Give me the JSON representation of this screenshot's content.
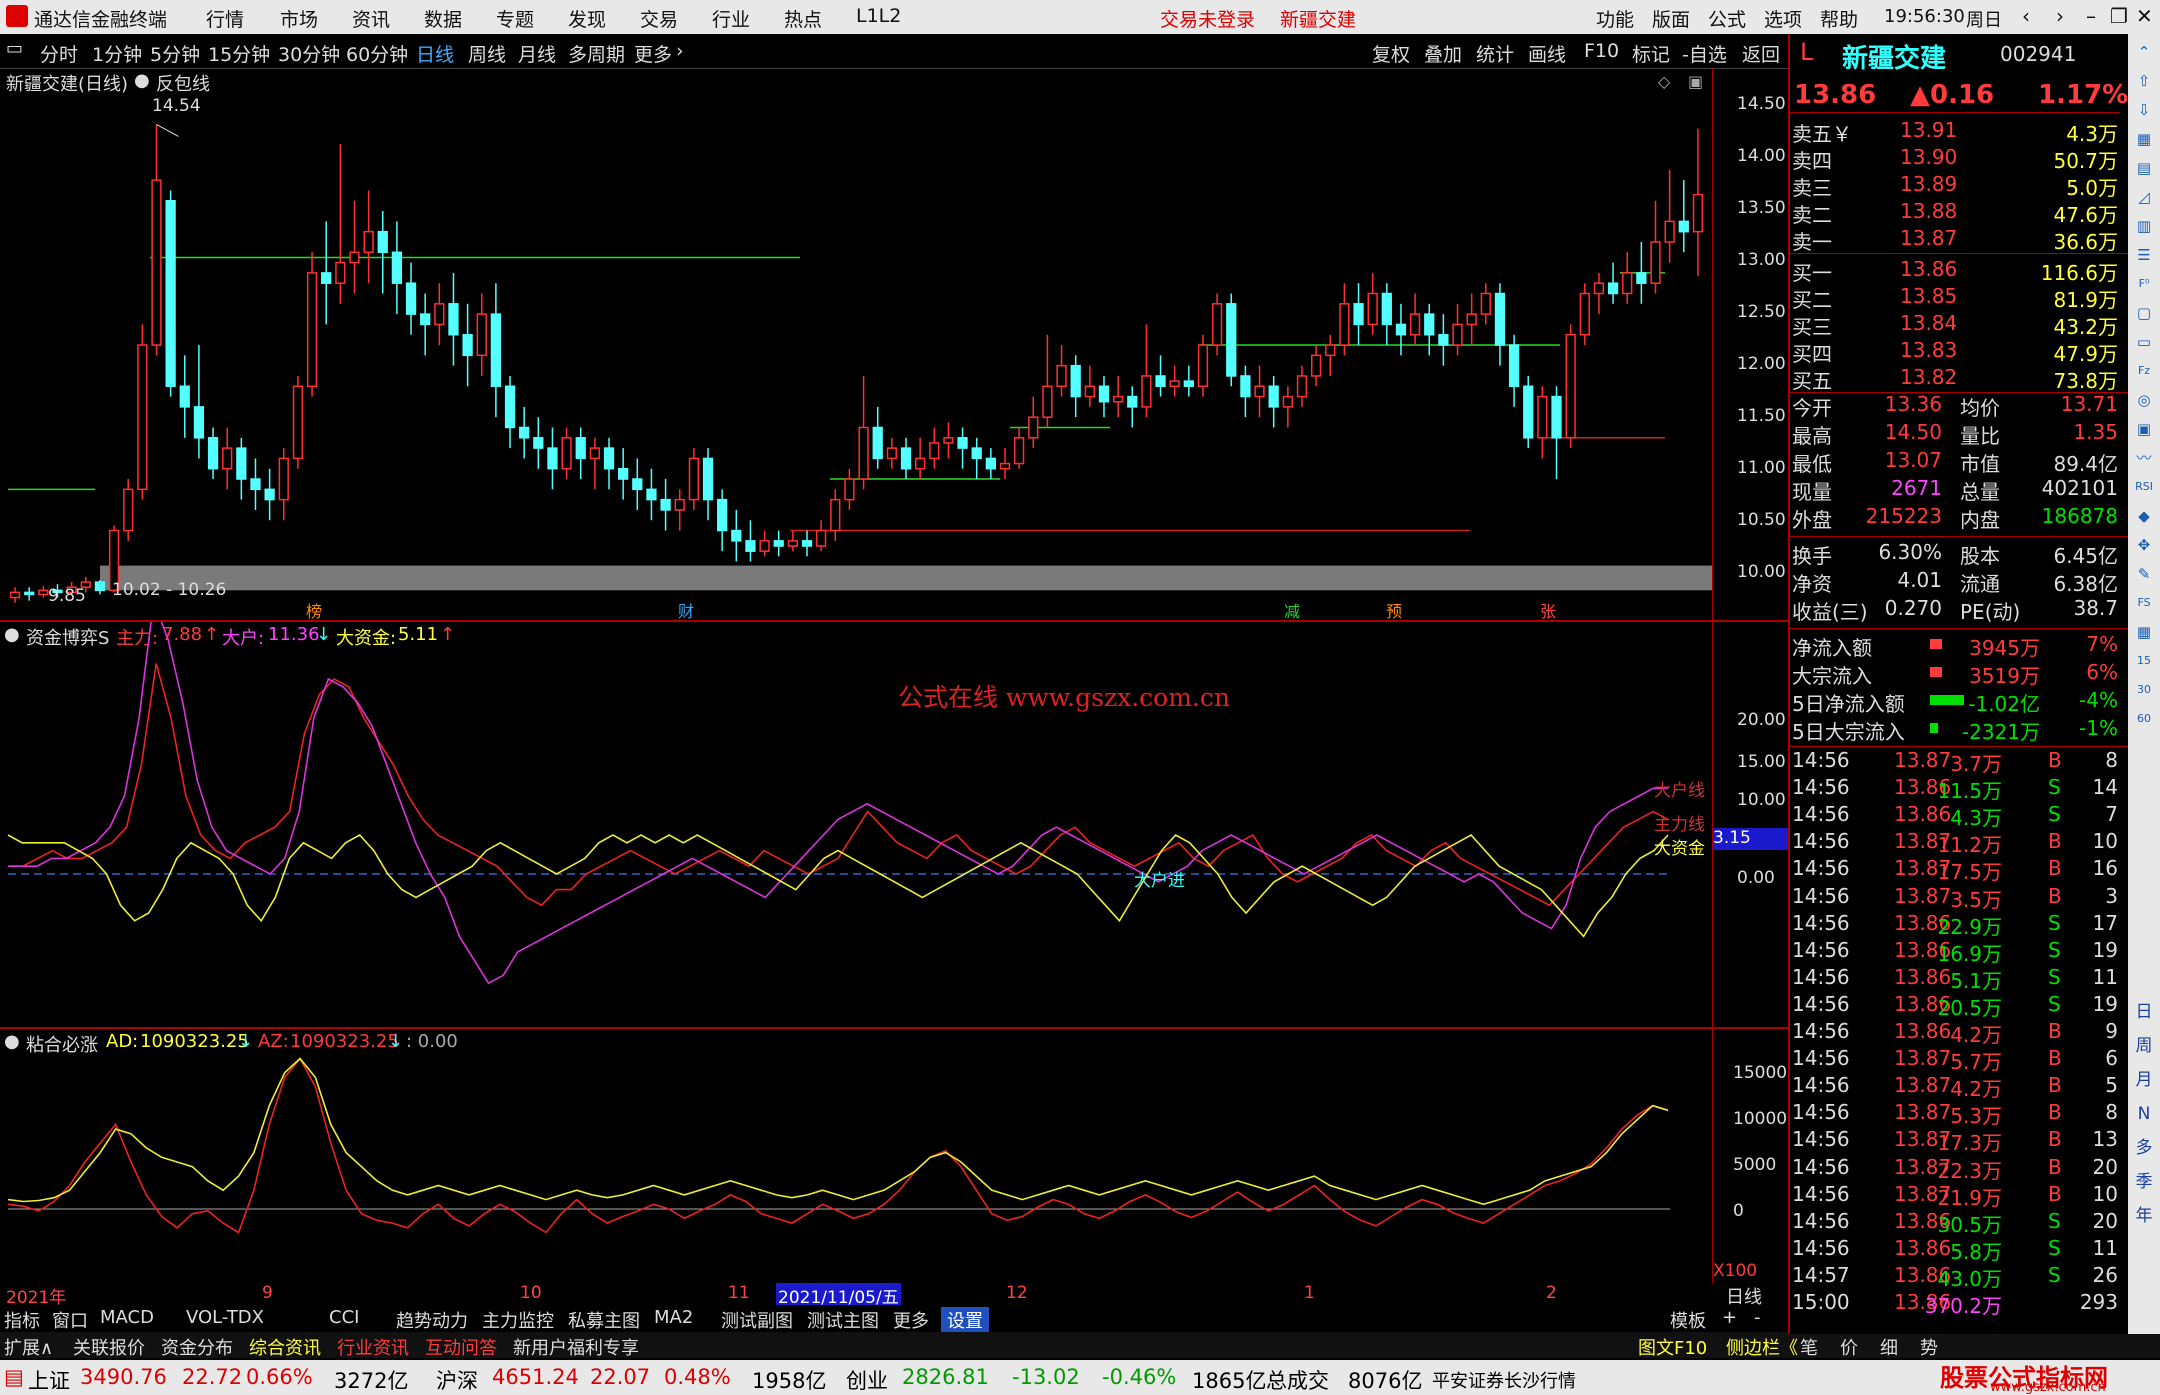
{
  "menu": {
    "app_title": "通达信金融终端",
    "items": [
      "行情",
      "市场",
      "资讯",
      "数据",
      "专题",
      "发现",
      "交易",
      "行业",
      "热点",
      "L1L2"
    ],
    "login_status": "交易未登录",
    "stock_name_menu": "新疆交建",
    "right_items": [
      "功能",
      "版面",
      "公式",
      "选项",
      "帮助"
    ],
    "time": "19:56:30",
    "weekday": "周日"
  },
  "periods": {
    "items": [
      "分时",
      "1分钟",
      "5分钟",
      "15分钟",
      "30分钟",
      "60分钟",
      "日线",
      "周线",
      "月线",
      "多周期",
      "更多"
    ],
    "active": "日线",
    "right": [
      "复权",
      "叠加",
      "统计",
      "画线",
      "F10",
      "标记",
      "-自选",
      "返回"
    ]
  },
  "main_chart": {
    "title": "新疆交建(日线)",
    "indicator": "反包线",
    "high_label": "14.54",
    "low_label": "9.85",
    "range_label": "10.02 - 10.26",
    "y_ticks": [
      "14.50",
      "14.00",
      "13.50",
      "13.00",
      "12.50",
      "12.00",
      "11.50",
      "11.00",
      "10.50",
      "10.00"
    ],
    "markers": [
      {
        "text": "榜",
        "color": "#ff8c00"
      },
      {
        "text": "财",
        "color": "#3af"
      },
      {
        "text": "减",
        "color": "#3c3"
      },
      {
        "text": "预",
        "color": "#ff8c00"
      },
      {
        "text": "张",
        "color": "#f44"
      }
    ]
  },
  "fund_chart": {
    "title": "资金博弈S",
    "main_label": "主力:",
    "main_value": "7.88",
    "big_label": "大户:",
    "big_value": "11.36",
    "large_label": "大资金:",
    "large_value": "5.11",
    "watermark": "公式在线 www.gszx.com.cn",
    "y_ticks": [
      "20.00",
      "15.00",
      "10.00",
      "5.00",
      "0.00"
    ],
    "tag_big": "大户线",
    "tag_main": "主力线",
    "tag_large": "大资金",
    "current": "3.15",
    "zero_label": "大户进"
  },
  "ad_chart": {
    "title": "粘合必涨",
    "ad_label": "AD:",
    "ad_value": "1090323.25",
    "az_label": "AZ:",
    "az_value": "1090323.25",
    "tail": ": 0.00",
    "y_ticks": [
      "15000",
      "10000",
      "5000",
      "0"
    ],
    "unit": "X100"
  },
  "date_axis": {
    "labels": [
      "2021年",
      "9",
      "10",
      "11",
      "2021/11/05/五",
      "12",
      "1",
      "2"
    ],
    "right": "日线"
  },
  "quote": {
    "l_icon": "L",
    "name": "新疆交建",
    "code": "002941",
    "price": "13.86",
    "change": "▲0.16",
    "pct": "1.17%",
    "asks": [
      {
        "label": "卖五￥",
        "price": "13.91",
        "vol": "4.3万"
      },
      {
        "label": "卖四",
        "price": "13.90",
        "vol": "50.7万"
      },
      {
        "label": "卖三",
        "price": "13.89",
        "vol": "5.0万"
      },
      {
        "label": "卖二",
        "price": "13.88",
        "vol": "47.6万"
      },
      {
        "label": "卖一",
        "price": "13.87",
        "vol": "36.6万"
      }
    ],
    "bids": [
      {
        "label": "买一",
        "price": "13.86",
        "vol": "116.6万"
      },
      {
        "label": "买二",
        "price": "13.85",
        "vol": "81.9万"
      },
      {
        "label": "买三",
        "price": "13.84",
        "vol": "43.2万"
      },
      {
        "label": "买四",
        "price": "13.83",
        "vol": "47.9万"
      },
      {
        "label": "买五",
        "price": "13.82",
        "vol": "73.8万"
      }
    ],
    "stats": [
      {
        "l1": "今开",
        "v1": "13.36",
        "c1": "red",
        "l2": "均价",
        "v2": "13.71",
        "c2": "red"
      },
      {
        "l1": "最高",
        "v1": "14.50",
        "c1": "red",
        "l2": "量比",
        "v2": "1.35",
        "c2": "red"
      },
      {
        "l1": "最低",
        "v1": "13.07",
        "c1": "red",
        "l2": "市值",
        "v2": "89.4亿",
        "c2": "wht"
      },
      {
        "l1": "现量",
        "v1": "2671",
        "c1": "mag",
        "l2": "总量",
        "v2": "402101",
        "c2": "wht"
      },
      {
        "l1": "外盘",
        "v1": "215223",
        "c1": "red",
        "l2": "内盘",
        "v2": "186878",
        "c2": "green"
      }
    ],
    "stats2": [
      {
        "l1": "换手",
        "v1": "6.30%",
        "l2": "股本",
        "v2": "6.45亿"
      },
      {
        "l1": "净资",
        "v1": "4.01",
        "l2": "流通",
        "v2": "6.38亿"
      },
      {
        "l1": "收益(三)",
        "v1": "0.270",
        "l2": "PE(动)",
        "v2": "38.7"
      }
    ],
    "flows": [
      {
        "label": "净流入额",
        "value": "3945万",
        "pct": "7%",
        "color": "red"
      },
      {
        "label": "大宗流入",
        "value": "3519万",
        "pct": "6%",
        "color": "red"
      },
      {
        "label": "5日净流入额",
        "value": "-1.02亿",
        "pct": "-4%",
        "color": "green"
      },
      {
        "label": "5日大宗流入",
        "value": "-2321万",
        "pct": "-1%",
        "color": "green"
      }
    ],
    "ticks": [
      [
        "14:56",
        "13.87",
        "3.7万",
        "B",
        "8"
      ],
      [
        "14:56",
        "13.86",
        "11.5万",
        "S",
        "14"
      ],
      [
        "14:56",
        "13.86",
        "4.3万",
        "S",
        "7"
      ],
      [
        "14:56",
        "13.87",
        "11.2万",
        "B",
        "10"
      ],
      [
        "14:56",
        "13.87",
        "17.5万",
        "B",
        "16"
      ],
      [
        "14:56",
        "13.87",
        "3.5万",
        "B",
        "3"
      ],
      [
        "14:56",
        "13.86",
        "22.9万",
        "S",
        "17"
      ],
      [
        "14:56",
        "13.86",
        "16.9万",
        "S",
        "19"
      ],
      [
        "14:56",
        "13.86",
        "5.1万",
        "S",
        "11"
      ],
      [
        "14:56",
        "13.86",
        "20.5万",
        "S",
        "19"
      ],
      [
        "14:56",
        "13.86",
        "4.2万",
        "B",
        "9"
      ],
      [
        "14:56",
        "13.87",
        "5.7万",
        "B",
        "6"
      ],
      [
        "14:56",
        "13.87",
        "4.2万",
        "B",
        "5"
      ],
      [
        "14:56",
        "13.87",
        "5.3万",
        "B",
        "8"
      ],
      [
        "14:56",
        "13.87",
        "17.3万",
        "B",
        "13"
      ],
      [
        "14:56",
        "13.87",
        "22.3万",
        "B",
        "20"
      ],
      [
        "14:56",
        "13.87",
        "21.9万",
        "B",
        "10"
      ],
      [
        "14:56",
        "13.86",
        "30.5万",
        "S",
        "20"
      ],
      [
        "14:56",
        "13.86",
        "5.8万",
        "S",
        "11"
      ],
      [
        "14:57",
        "13.86",
        "43.0万",
        "S",
        "26"
      ],
      [
        "15:00",
        "13.86",
        "370.2万",
        "",
        "293"
      ]
    ]
  },
  "tabs1": [
    "指标",
    "窗口",
    "MACD",
    "VOL-TDX",
    "CCI",
    "趋势动力",
    "主力监控",
    "私募主图",
    "MA2",
    "测试副图",
    "测试主图",
    "更多",
    "设置"
  ],
  "tabs1_right": [
    "模板",
    "+",
    "-"
  ],
  "tabs2": [
    "扩展∧",
    "关联报价",
    "资金分布",
    "综合资讯",
    "行业资讯",
    "互动问答",
    "新用户福利专享"
  ],
  "tabs2_right": [
    "图文F10",
    "侧边栏《",
    "笔",
    "价",
    "细",
    "势"
  ],
  "status": {
    "items": [
      {
        "name": "上证",
        "price": "3490.76",
        "chg": "22.72",
        "pct": "0.66%",
        "amt": "3272亿"
      },
      {
        "name": "沪深",
        "price": "4651.24",
        "chg": "22.07",
        "pct": "0.48%",
        "amt": "1958亿"
      },
      {
        "name": "创业",
        "price": "2826.81",
        "chg": "-13.02",
        "pct": "-0.46%",
        "amt": "1865亿"
      }
    ],
    "total_label": "总成交",
    "total": "8076亿",
    "broker": "平安证券长沙行情",
    "brand": "股票公式指标网",
    "brand_url": "www.gszx.com.cn"
  },
  "chart_data": [
    {
      "type": "candlestick",
      "title": "新疆交建(日线)",
      "ylim": [
        9.8,
        14.7
      ],
      "candles": [
        [
          9.95,
          10.0,
          9.9,
          10.05
        ],
        [
          10.0,
          9.98,
          9.92,
          10.05
        ],
        [
          9.98,
          10.02,
          9.95,
          10.06
        ],
        [
          10.02,
          10.0,
          9.95,
          10.08
        ],
        [
          10.0,
          10.05,
          9.98,
          10.1
        ],
        [
          10.05,
          10.1,
          10.0,
          10.15
        ],
        [
          10.1,
          10.02,
          9.98,
          10.12
        ],
        [
          10.02,
          10.6,
          10.0,
          10.65
        ],
        [
          10.6,
          11.0,
          10.5,
          11.1
        ],
        [
          11.0,
          12.4,
          10.9,
          12.6
        ],
        [
          12.4,
          14.0,
          12.3,
          14.54
        ],
        [
          13.8,
          12.0,
          11.9,
          13.9
        ],
        [
          12.0,
          11.8,
          11.5,
          12.3
        ],
        [
          11.8,
          11.5,
          11.3,
          12.4
        ],
        [
          11.5,
          11.2,
          11.1,
          11.6
        ],
        [
          11.2,
          11.4,
          11.0,
          11.6
        ],
        [
          11.4,
          11.1,
          10.9,
          11.5
        ],
        [
          11.1,
          11.0,
          10.8,
          11.3
        ],
        [
          11.0,
          10.9,
          10.7,
          11.2
        ],
        [
          10.9,
          11.3,
          10.7,
          11.4
        ],
        [
          11.3,
          12.0,
          11.2,
          12.1
        ],
        [
          12.0,
          13.1,
          11.9,
          13.3
        ],
        [
          13.1,
          13.0,
          12.6,
          13.6
        ],
        [
          13.0,
          13.2,
          12.8,
          14.35
        ],
        [
          13.2,
          13.3,
          12.9,
          13.8
        ],
        [
          13.3,
          13.5,
          13.0,
          13.9
        ],
        [
          13.5,
          13.3,
          12.9,
          13.7
        ],
        [
          13.3,
          13.0,
          12.7,
          13.6
        ],
        [
          13.0,
          12.7,
          12.5,
          13.2
        ],
        [
          12.7,
          12.6,
          12.3,
          12.9
        ],
        [
          12.6,
          12.8,
          12.4,
          13.0
        ],
        [
          12.8,
          12.5,
          12.2,
          13.1
        ],
        [
          12.5,
          12.3,
          12.0,
          12.8
        ],
        [
          12.3,
          12.7,
          12.1,
          12.9
        ],
        [
          12.7,
          12.0,
          11.7,
          13.0
        ],
        [
          12.0,
          11.6,
          11.4,
          12.1
        ],
        [
          11.6,
          11.5,
          11.3,
          11.8
        ],
        [
          11.5,
          11.4,
          11.2,
          11.7
        ],
        [
          11.4,
          11.2,
          11.0,
          11.6
        ],
        [
          11.2,
          11.5,
          11.1,
          11.6
        ],
        [
          11.5,
          11.3,
          11.1,
          11.6
        ],
        [
          11.3,
          11.4,
          11.0,
          11.5
        ],
        [
          11.4,
          11.2,
          11.0,
          11.5
        ],
        [
          11.2,
          11.1,
          10.9,
          11.4
        ],
        [
          11.1,
          11.0,
          10.8,
          11.3
        ],
        [
          11.0,
          10.9,
          10.7,
          11.2
        ],
        [
          10.9,
          10.8,
          10.6,
          11.1
        ],
        [
          10.8,
          10.9,
          10.6,
          11.0
        ],
        [
          10.9,
          11.3,
          10.8,
          11.4
        ],
        [
          11.3,
          10.9,
          10.7,
          11.4
        ],
        [
          10.9,
          10.6,
          10.4,
          11.0
        ],
        [
          10.6,
          10.5,
          10.3,
          10.8
        ],
        [
          10.5,
          10.4,
          10.3,
          10.7
        ],
        [
          10.4,
          10.5,
          10.35,
          10.6
        ],
        [
          10.5,
          10.45,
          10.35,
          10.6
        ],
        [
          10.45,
          10.5,
          10.4,
          10.6
        ],
        [
          10.5,
          10.45,
          10.35,
          10.6
        ],
        [
          10.45,
          10.6,
          10.4,
          10.7
        ],
        [
          10.6,
          10.9,
          10.5,
          11.0
        ],
        [
          10.9,
          11.1,
          10.8,
          11.2
        ],
        [
          11.1,
          11.6,
          11.0,
          12.1
        ],
        [
          11.6,
          11.3,
          11.2,
          11.8
        ],
        [
          11.3,
          11.4,
          11.2,
          11.5
        ],
        [
          11.4,
          11.2,
          11.1,
          11.5
        ],
        [
          11.2,
          11.3,
          11.1,
          11.5
        ],
        [
          11.3,
          11.45,
          11.2,
          11.6
        ],
        [
          11.45,
          11.5,
          11.3,
          11.65
        ],
        [
          11.5,
          11.4,
          11.2,
          11.6
        ],
        [
          11.4,
          11.3,
          11.1,
          11.5
        ],
        [
          11.3,
          11.2,
          11.1,
          11.4
        ],
        [
          11.2,
          11.25,
          11.1,
          11.4
        ],
        [
          11.25,
          11.5,
          11.2,
          11.6
        ],
        [
          11.5,
          11.7,
          11.4,
          11.9
        ],
        [
          11.7,
          12.0,
          11.6,
          12.5
        ],
        [
          12.0,
          12.2,
          11.9,
          12.4
        ],
        [
          12.2,
          11.9,
          11.7,
          12.3
        ],
        [
          11.9,
          12.0,
          11.8,
          12.2
        ],
        [
          12.0,
          11.85,
          11.7,
          12.1
        ],
        [
          11.85,
          11.9,
          11.7,
          12.1
        ],
        [
          11.9,
          11.8,
          11.6,
          12.0
        ],
        [
          11.8,
          12.1,
          11.7,
          12.6
        ],
        [
          12.1,
          12.0,
          11.9,
          12.3
        ],
        [
          12.0,
          12.05,
          11.9,
          12.2
        ],
        [
          12.05,
          12.0,
          11.9,
          12.2
        ],
        [
          12.0,
          12.4,
          11.9,
          12.5
        ],
        [
          12.4,
          12.8,
          12.3,
          12.9
        ],
        [
          12.8,
          12.1,
          12.0,
          12.9
        ],
        [
          12.1,
          11.9,
          11.7,
          12.2
        ],
        [
          11.9,
          12.0,
          11.7,
          12.2
        ],
        [
          12.0,
          11.8,
          11.6,
          12.1
        ],
        [
          11.8,
          11.9,
          11.6,
          12.0
        ],
        [
          11.9,
          12.1,
          11.8,
          12.2
        ],
        [
          12.1,
          12.3,
          12.0,
          12.4
        ],
        [
          12.3,
          12.4,
          12.1,
          12.5
        ],
        [
          12.4,
          12.8,
          12.3,
          13.0
        ],
        [
          12.8,
          12.6,
          12.4,
          13.0
        ],
        [
          12.6,
          12.9,
          12.5,
          13.1
        ],
        [
          12.9,
          12.6,
          12.4,
          13.0
        ],
        [
          12.6,
          12.5,
          12.3,
          12.8
        ],
        [
          12.5,
          12.7,
          12.4,
          12.9
        ],
        [
          12.7,
          12.5,
          12.3,
          12.8
        ],
        [
          12.5,
          12.4,
          12.2,
          12.7
        ],
        [
          12.4,
          12.6,
          12.3,
          12.8
        ],
        [
          12.6,
          12.7,
          12.4,
          12.9
        ],
        [
          12.7,
          12.9,
          12.6,
          13.0
        ],
        [
          12.9,
          12.4,
          12.2,
          13.0
        ],
        [
          12.4,
          12.0,
          11.8,
          12.5
        ],
        [
          12.0,
          11.5,
          11.4,
          12.1
        ],
        [
          11.5,
          11.9,
          11.3,
          12.0
        ],
        [
          11.9,
          11.5,
          11.1,
          12.0
        ],
        [
          11.5,
          12.5,
          11.4,
          12.6
        ],
        [
          12.5,
          12.9,
          12.4,
          13.0
        ],
        [
          12.9,
          13.0,
          12.7,
          13.1
        ],
        [
          13.0,
          12.9,
          12.8,
          13.2
        ],
        [
          12.9,
          13.1,
          12.8,
          13.3
        ],
        [
          13.1,
          13.0,
          12.8,
          13.4
        ],
        [
          13.0,
          13.4,
          12.9,
          13.8
        ],
        [
          13.4,
          13.6,
          13.2,
          14.1
        ],
        [
          13.6,
          13.5,
          13.3,
          14.0
        ],
        [
          13.5,
          13.86,
          13.07,
          14.5
        ]
      ]
    }
  ]
}
